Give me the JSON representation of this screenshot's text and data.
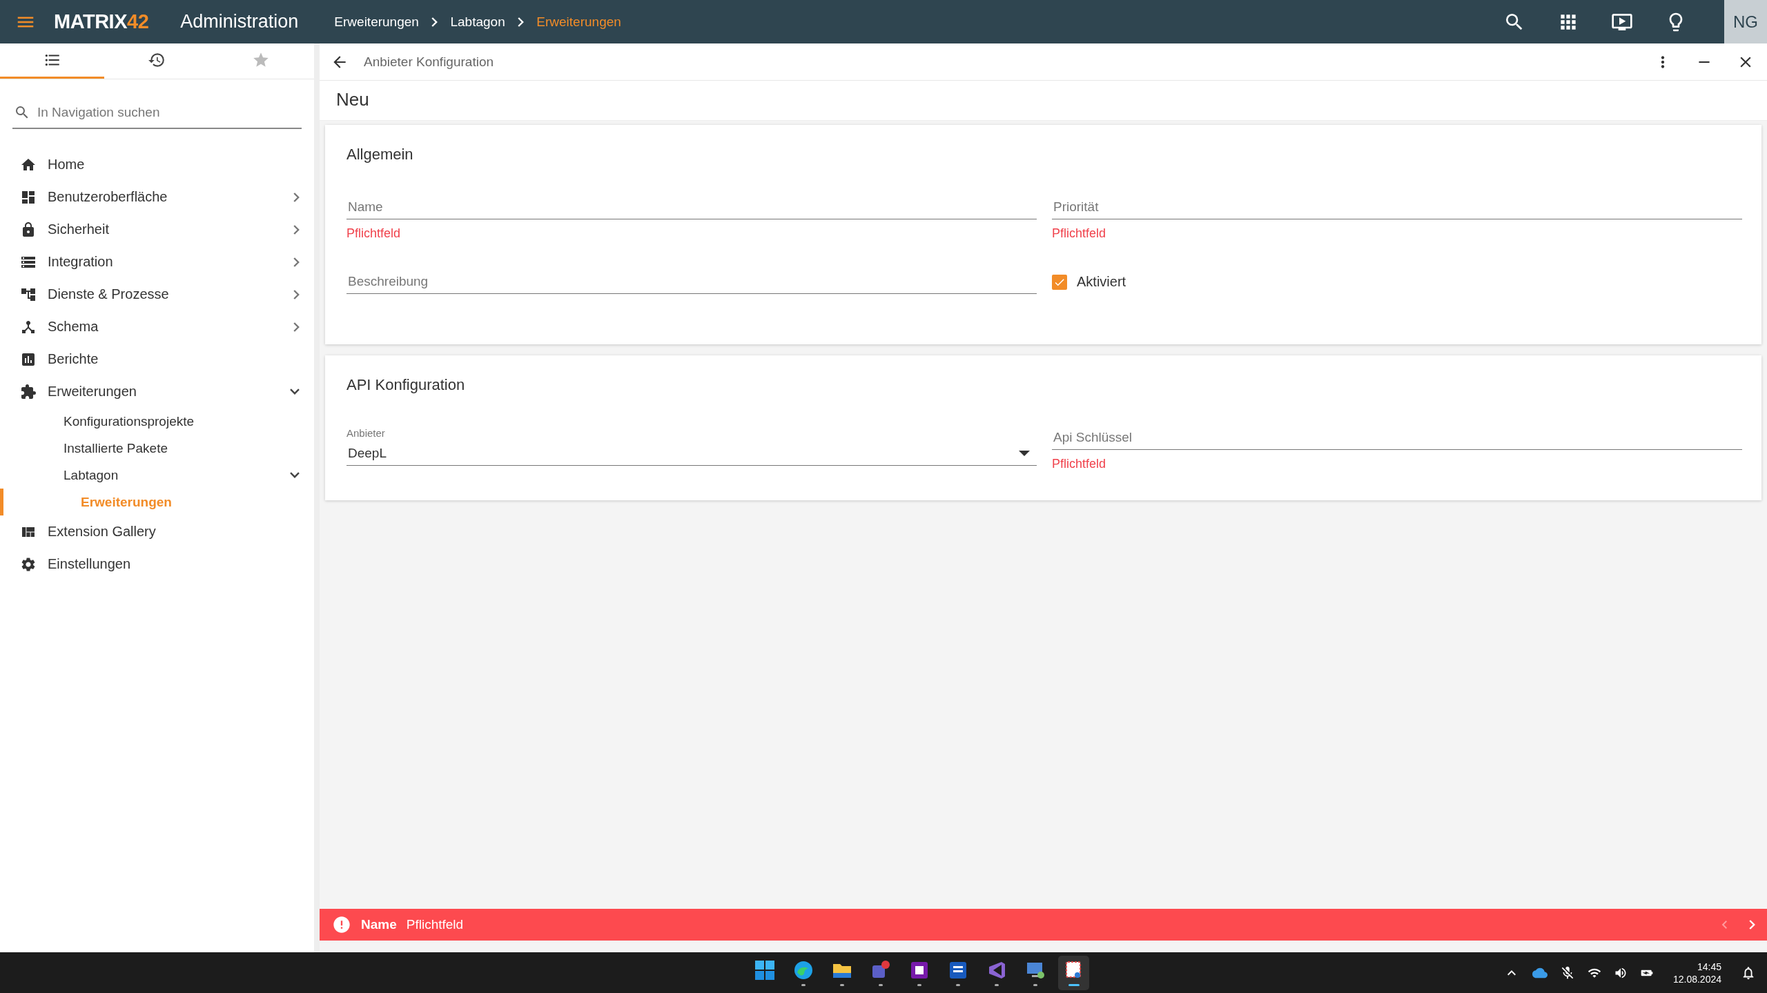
{
  "header": {
    "logo": "MATRIX",
    "logo_accent": "42",
    "title": "Administration",
    "breadcrumbs": [
      {
        "label": "Erweiterungen",
        "current": false
      },
      {
        "label": "Labtagon",
        "current": false
      },
      {
        "label": "Erweiterungen",
        "current": true
      }
    ],
    "user_initials": "NG"
  },
  "sidebar": {
    "tabs": [
      {
        "kind": "list",
        "selected": true
      },
      {
        "kind": "history",
        "selected": false
      },
      {
        "kind": "favorites",
        "selected": false
      }
    ],
    "search": {
      "placeholder": "In Navigation suchen"
    },
    "items": [
      {
        "kind": "home",
        "label": "Home",
        "selected": false
      },
      {
        "kind": "ui",
        "label": "Benutzeroberfläche",
        "selected": false,
        "expanded": false
      },
      {
        "kind": "lock",
        "label": "Sicherheit",
        "selected": false,
        "expanded": false
      },
      {
        "kind": "integration",
        "label": "Integration",
        "selected": false,
        "expanded": false
      },
      {
        "kind": "services",
        "label": "Dienste & Prozesse",
        "selected": false,
        "expanded": false
      },
      {
        "kind": "schema",
        "label": "Schema",
        "selected": false,
        "expanded": false
      },
      {
        "kind": "reports",
        "label": "Berichte",
        "selected": false
      },
      {
        "kind": "extensions",
        "label": "Erweiterungen",
        "selected": false,
        "expanded": true,
        "children": [
          {
            "label": "Konfigurationsprojekte",
            "selected": false
          },
          {
            "label": "Installierte Pakete",
            "selected": false
          },
          {
            "label": "Labtagon",
            "selected": false,
            "expanded": true,
            "children": [
              {
                "label": "Erweiterungen",
                "selected": true
              }
            ]
          }
        ]
      },
      {
        "kind": "gallery",
        "label": "Extension Gallery",
        "selected": false
      },
      {
        "kind": "settings",
        "label": "Einstellungen",
        "selected": false
      }
    ]
  },
  "panel": {
    "title": "Anbieter Konfiguration",
    "page_title": "Neu",
    "cards": [
      {
        "title": "Allgemein",
        "fields": [
          {
            "kind": "text",
            "placeholder": "Name",
            "error": "Pflichtfeld"
          },
          {
            "kind": "text",
            "placeholder": "Priorität",
            "error": "Pflichtfeld"
          },
          {
            "kind": "text",
            "placeholder": "Beschreibung"
          },
          {
            "kind": "checkbox",
            "label": "Aktiviert",
            "checked": true
          }
        ]
      },
      {
        "title": "API Konfiguration",
        "fields": [
          {
            "kind": "select",
            "label": "Anbieter",
            "value": "DeepL"
          },
          {
            "kind": "text",
            "placeholder": "Api Schlüssel",
            "error": "Pflichtfeld"
          }
        ]
      }
    ],
    "error_bar": {
      "field": "Name",
      "message": "Pflichtfeld",
      "prev_disabled": true,
      "next_disabled": false
    }
  },
  "taskbar": {
    "apps": [
      {
        "kind": "start",
        "running": false,
        "selected": false
      },
      {
        "kind": "browser",
        "running": true,
        "selected": false
      },
      {
        "kind": "folder",
        "running": true,
        "selected": false
      },
      {
        "kind": "chat",
        "running": true,
        "selected": false
      },
      {
        "kind": "notebook",
        "running": true,
        "selected": false
      },
      {
        "kind": "document",
        "running": true,
        "selected": false
      },
      {
        "kind": "code",
        "running": true,
        "selected": false
      },
      {
        "kind": "remote",
        "running": true,
        "selected": false
      },
      {
        "kind": "snip",
        "running": true,
        "selected": true
      }
    ],
    "time": "14:45",
    "date": "12.08.2024"
  }
}
